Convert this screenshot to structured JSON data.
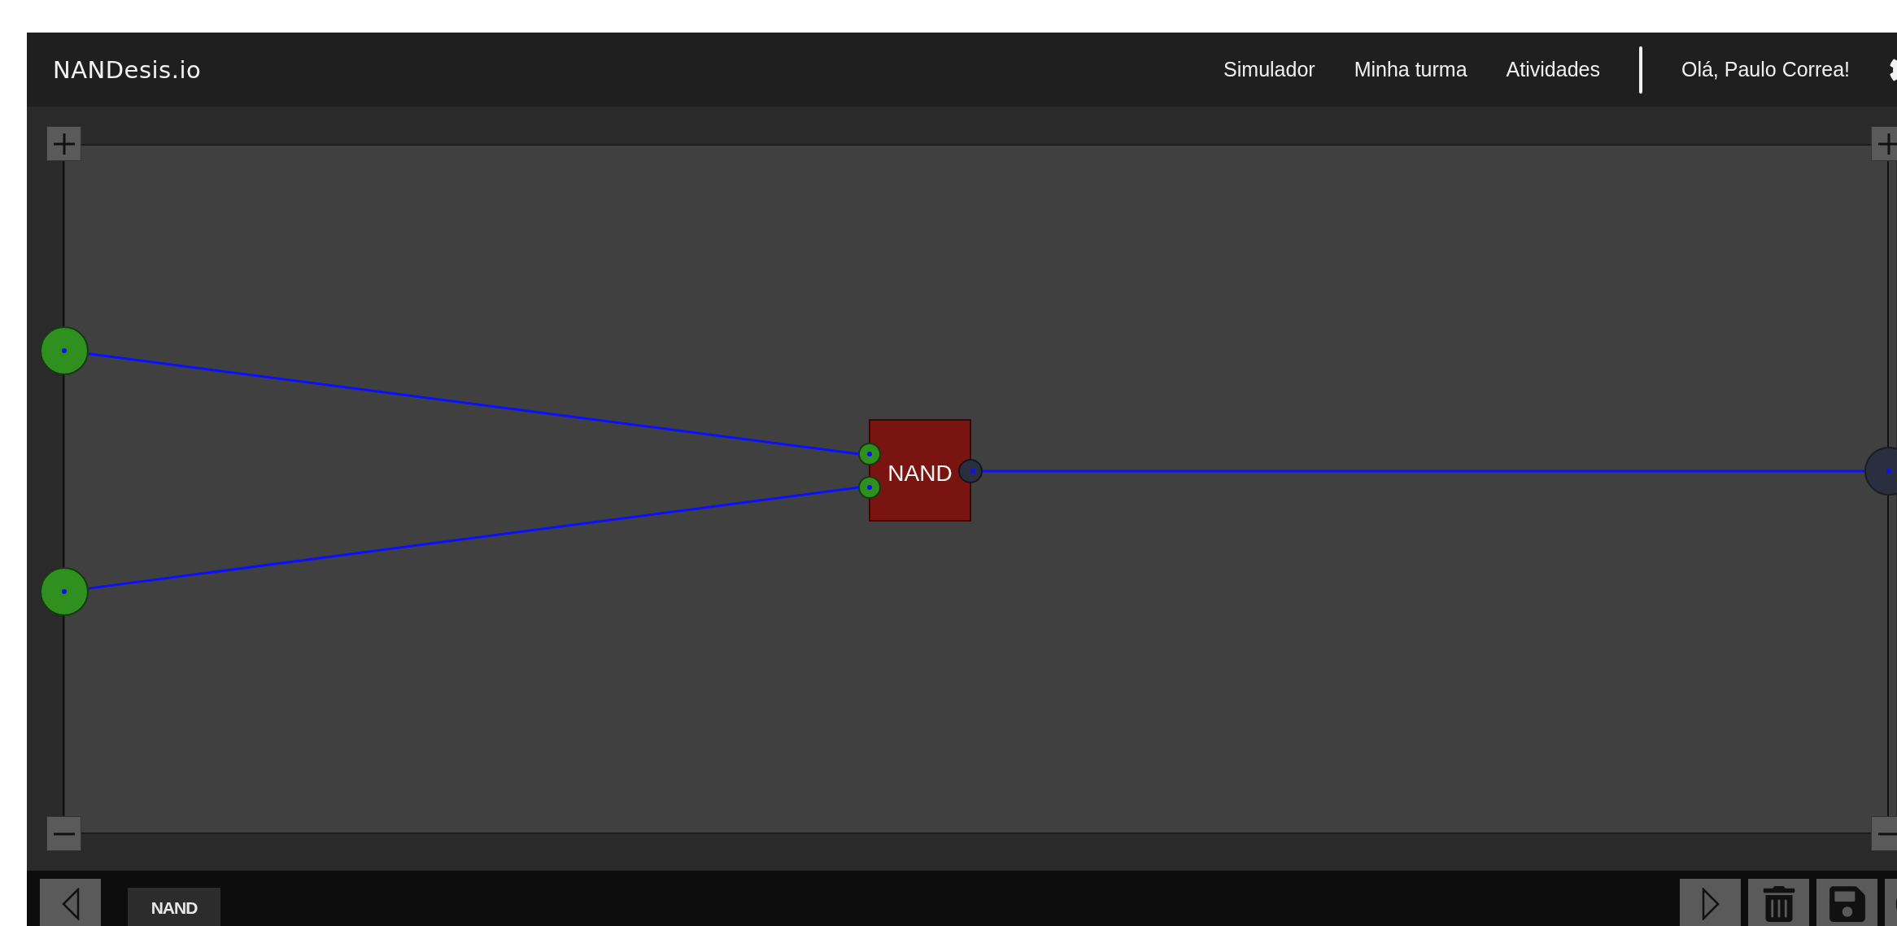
{
  "header": {
    "logo": "NANDesis.io",
    "nav": [
      {
        "label": "Simulador"
      },
      {
        "label": "Minha turma"
      },
      {
        "label": "Atividades"
      }
    ],
    "greeting": "Olá, Paulo Correa!"
  },
  "circuit": {
    "inputs": [
      {
        "on": true
      },
      {
        "on": true
      }
    ],
    "gate": {
      "label": "NAND",
      "input_pins": [
        {
          "on": true
        },
        {
          "on": true
        }
      ],
      "output_on": false
    },
    "outputs": [
      {
        "on": false
      }
    ]
  },
  "toolbar": {
    "components": [
      {
        "label": "NAND"
      }
    ]
  }
}
